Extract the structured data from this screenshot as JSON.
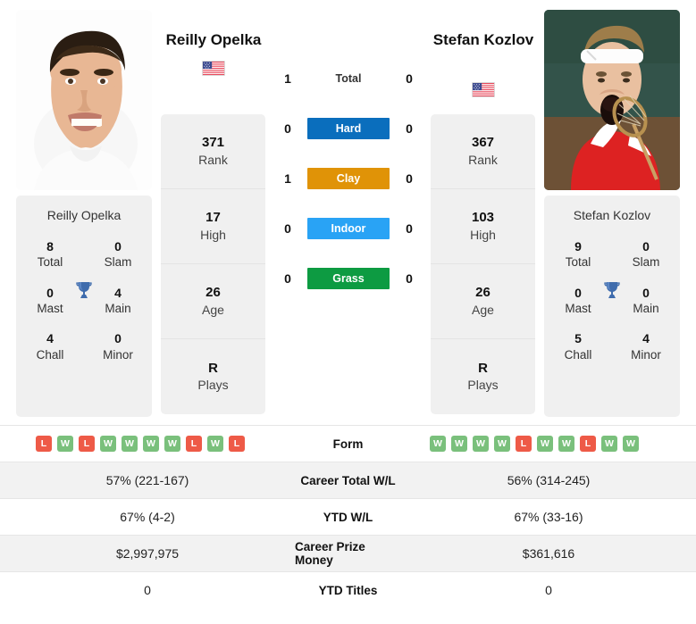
{
  "players": {
    "left": {
      "name": "Reilly Opelka",
      "flag": "us-flag-icon",
      "panel_name": "Reilly Opelka",
      "rank": "371",
      "rank_label": "Rank",
      "high": "17",
      "high_label": "High",
      "age": "26",
      "age_label": "Age",
      "plays": "R",
      "plays_label": "Plays",
      "titles": {
        "total": "8",
        "total_label": "Total",
        "slam": "0",
        "slam_label": "Slam",
        "mast": "0",
        "mast_label": "Mast",
        "main": "4",
        "main_label": "Main",
        "chall": "4",
        "chall_label": "Chall",
        "minor": "0",
        "minor_label": "Minor"
      },
      "form": [
        "L",
        "W",
        "L",
        "W",
        "W",
        "W",
        "W",
        "L",
        "W",
        "L"
      ],
      "career_wl": "57% (221-167)",
      "ytd_wl": "67% (4-2)",
      "career_prize": "$2,997,975",
      "ytd_titles": "0"
    },
    "right": {
      "name": "Stefan Kozlov",
      "flag": "us-flag-icon",
      "panel_name": "Stefan Kozlov",
      "rank": "367",
      "rank_label": "Rank",
      "high": "103",
      "high_label": "High",
      "age": "26",
      "age_label": "Age",
      "plays": "R",
      "plays_label": "Plays",
      "titles": {
        "total": "9",
        "total_label": "Total",
        "slam": "0",
        "slam_label": "Slam",
        "mast": "0",
        "mast_label": "Mast",
        "main": "0",
        "main_label": "Main",
        "chall": "5",
        "chall_label": "Chall",
        "minor": "4",
        "minor_label": "Minor"
      },
      "form": [
        "W",
        "W",
        "W",
        "W",
        "L",
        "W",
        "W",
        "L",
        "W",
        "W"
      ],
      "career_wl": "56% (314-245)",
      "ytd_wl": "67% (33-16)",
      "career_prize": "$361,616",
      "ytd_titles": "0"
    }
  },
  "h2h": [
    {
      "label": "Total",
      "left": "1",
      "right": "0",
      "color": "",
      "style": "plain"
    },
    {
      "label": "Hard",
      "left": "0",
      "right": "0",
      "color": "#0a6ebd",
      "style": "filled"
    },
    {
      "label": "Clay",
      "left": "1",
      "right": "0",
      "color": "#e09307",
      "style": "filled"
    },
    {
      "label": "Indoor",
      "left": "0",
      "right": "0",
      "color": "#29a3f5",
      "style": "filled"
    },
    {
      "label": "Grass",
      "left": "0",
      "right": "0",
      "color": "#0d9b42",
      "style": "filled"
    }
  ],
  "table_rows": [
    {
      "label": "Form",
      "key": "form"
    },
    {
      "label": "Career Total W/L",
      "key": "career_wl"
    },
    {
      "label": "YTD W/L",
      "key": "ytd_wl"
    },
    {
      "label": "Career Prize Money",
      "key": "career_prize"
    },
    {
      "label": "YTD Titles",
      "key": "ytd_titles"
    }
  ]
}
